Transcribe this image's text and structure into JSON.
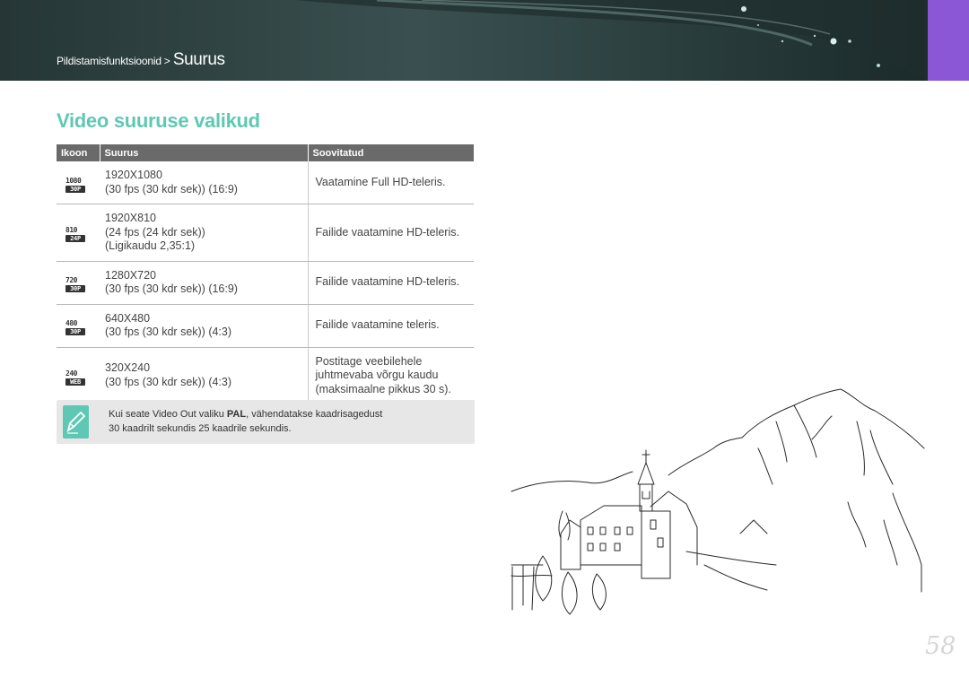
{
  "breadcrumb": {
    "parent": "Pildistamisfunktsioonid",
    "separator": ">",
    "current": "Suurus"
  },
  "page_title": "Video suuruse valikud",
  "table": {
    "headers": [
      "Ikoon",
      "Suurus",
      "Soovitatud"
    ],
    "rows": [
      {
        "icon": {
          "top": "1080",
          "bottom": "30P",
          "name": "video-1080-30p-icon"
        },
        "size_lines": [
          "1920X1080",
          "(30 fps (30 kdr sek)) (16:9)"
        ],
        "recommended": "Vaatamine Full HD-teleris."
      },
      {
        "icon": {
          "top": "810",
          "bottom": "24P",
          "name": "video-810-24p-icon"
        },
        "size_lines": [
          "1920X810",
          "(24 fps (24 kdr sek))",
          "(Ligikaudu 2,35:1)"
        ],
        "recommended": "Failide vaatamine HD-teleris."
      },
      {
        "icon": {
          "top": "720",
          "bottom": "30P",
          "name": "video-720-30p-icon"
        },
        "size_lines": [
          "1280X720",
          "(30 fps (30 kdr sek)) (16:9)"
        ],
        "recommended": "Failide vaatamine HD-teleris."
      },
      {
        "icon": {
          "top": "480",
          "bottom": "30P",
          "name": "video-480-30p-icon"
        },
        "size_lines": [
          "640X480",
          "(30 fps (30 kdr sek)) (4:3)"
        ],
        "recommended": "Failide vaatamine teleris."
      },
      {
        "icon": {
          "top": "240",
          "bottom": "WEB",
          "name": "video-240-web-icon"
        },
        "size_lines": [
          "320X240",
          "(30 fps (30 kdr sek)) (4:3)"
        ],
        "recommended": "Postitage veebilehele juhtmevaba võrgu kaudu (maksimaalne pikkus 30 s)."
      }
    ]
  },
  "note": {
    "icon": "pencil-note-icon",
    "text_before": "Kui seate Video Out valiku ",
    "text_bold": "PAL",
    "text_after_line1": ", vähendatakse kaadrisagedust",
    "text_line2": "30 kaadrilt sekundis 25 kaadrile sekundis."
  },
  "page_number": "58",
  "colors": {
    "title": "#5fc8b4",
    "banner": "#2f4545",
    "accent_tab": "#8b57d6",
    "table_header": "#6a6a6a",
    "note_bg": "#e7e7e7"
  }
}
